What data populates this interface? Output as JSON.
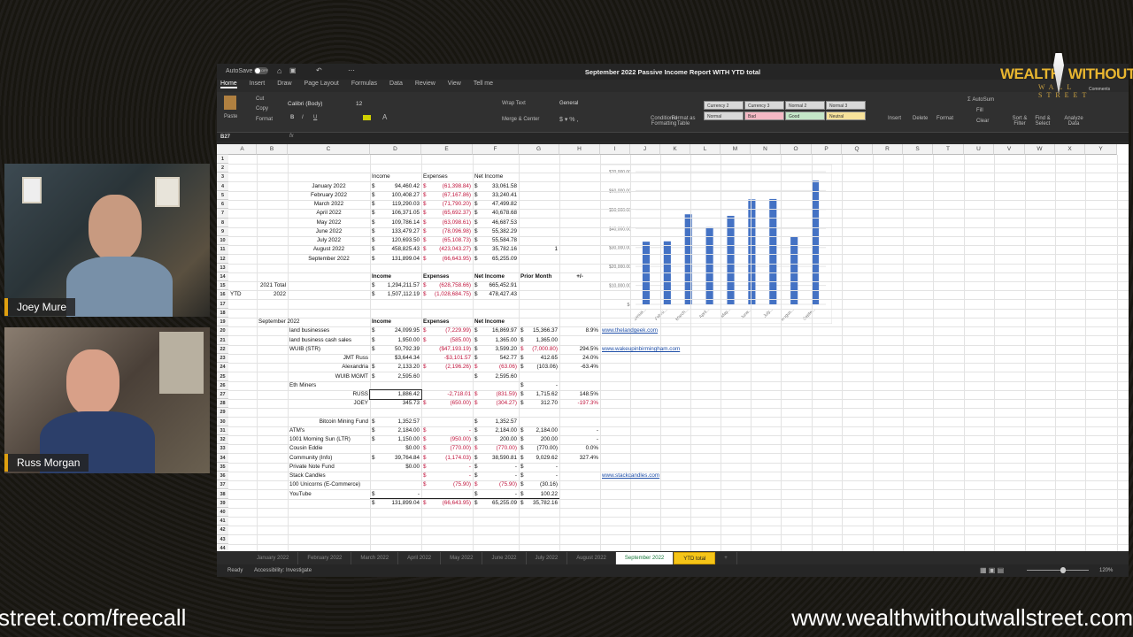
{
  "window": {
    "title": "September 2022 Passive Income Report WITH YTD total",
    "autosave": "AutoSave",
    "autosave_state": "OFF"
  },
  "menu": [
    "Home",
    "Insert",
    "Draw",
    "Page Layout",
    "Formulas",
    "Data",
    "Review",
    "View",
    "Tell me"
  ],
  "ribbon": {
    "paste": "Paste",
    "cut": "Cut",
    "copy": "Copy",
    "format_painter": "Format",
    "font": "Calibri (Body)",
    "font_size": "12",
    "wrap": "Wrap Text",
    "merge": "Merge & Center",
    "number_format": "General",
    "conditional": "Conditional Formatting",
    "format_table": "Format as Table",
    "styles": [
      {
        "label": "Currency 2",
        "color": "#d9d9d9"
      },
      {
        "label": "Currency 3",
        "color": "#d9d9d9"
      },
      {
        "label": "Normal 2",
        "color": "#d9d9d9"
      },
      {
        "label": "Normal 3",
        "color": "#d9d9d9"
      },
      {
        "label": "Normal",
        "color": "#d9d9d9"
      },
      {
        "label": "Bad",
        "color": "#f4b8c4"
      },
      {
        "label": "Good",
        "color": "#c4e6c8"
      },
      {
        "label": "Neutral",
        "color": "#f7e29a"
      }
    ],
    "insert": "Insert",
    "delete": "Delete",
    "format": "Format",
    "autosum": "AutoSum",
    "fill": "Fill",
    "clear": "Clear",
    "sort": "Sort & Filter",
    "find": "Find & Select",
    "analyze": "Analyze Data",
    "comments": "Comments"
  },
  "formula_bar": {
    "cell_ref": "B27",
    "fx": "fx",
    "value": ""
  },
  "columns": [
    "A",
    "B",
    "C",
    "D",
    "E",
    "F",
    "G",
    "H",
    "I",
    "J",
    "K",
    "L",
    "M",
    "N",
    "O",
    "P",
    "Q",
    "R",
    "S",
    "T",
    "U",
    "V",
    "W",
    "X",
    "Y"
  ],
  "rows": [
    {
      "r": 3,
      "cells": [
        [
          "D",
          "Income",
          "l"
        ],
        [
          "E",
          "Expenses",
          "l"
        ],
        [
          "F",
          "Net Income",
          "l"
        ]
      ]
    },
    {
      "r": 4,
      "cells": [
        [
          "C",
          "January 2022",
          "c"
        ],
        [
          "D",
          "$ 94,460.42",
          ""
        ],
        [
          "E",
          "$ (61,398.84)",
          "neg"
        ],
        [
          "F",
          "$ 33,061.58",
          ""
        ]
      ]
    },
    {
      "r": 5,
      "cells": [
        [
          "C",
          "February 2022",
          "c"
        ],
        [
          "D",
          "$ 100,408.27",
          ""
        ],
        [
          "E",
          "$ (67,167.86)",
          "neg"
        ],
        [
          "F",
          "$ 33,240.41",
          ""
        ]
      ]
    },
    {
      "r": 6,
      "cells": [
        [
          "C",
          "March 2022",
          "c"
        ],
        [
          "D",
          "$ 119,290.03",
          ""
        ],
        [
          "E",
          "$ (71,790.20)",
          "neg"
        ],
        [
          "F",
          "$ 47,499.82",
          ""
        ]
      ]
    },
    {
      "r": 7,
      "cells": [
        [
          "C",
          "April 2022",
          "c"
        ],
        [
          "D",
          "$ 106,371.05",
          ""
        ],
        [
          "E",
          "$ (65,692.37)",
          "neg"
        ],
        [
          "F",
          "$ 40,678.68",
          ""
        ]
      ]
    },
    {
      "r": 8,
      "cells": [
        [
          "C",
          "May 2022",
          "c"
        ],
        [
          "D",
          "$ 109,786.14",
          ""
        ],
        [
          "E",
          "$ (63,098.61)",
          "neg"
        ],
        [
          "F",
          "$ 46,687.53",
          ""
        ]
      ]
    },
    {
      "r": 9,
      "cells": [
        [
          "C",
          "June 2022",
          "c"
        ],
        [
          "D",
          "$ 133,479.27",
          ""
        ],
        [
          "E",
          "$ (78,096.98)",
          "neg"
        ],
        [
          "F",
          "$ 55,382.29",
          ""
        ]
      ]
    },
    {
      "r": 10,
      "cells": [
        [
          "C",
          "July 2022",
          "c"
        ],
        [
          "D",
          "$ 120,693.50",
          ""
        ],
        [
          "E",
          "$ (65,108.73)",
          "neg"
        ],
        [
          "F",
          "$ 55,584.78",
          ""
        ]
      ]
    },
    {
      "r": 11,
      "cells": [
        [
          "C",
          "August 2022",
          "c"
        ],
        [
          "D",
          "$ 458,825.43",
          ""
        ],
        [
          "E",
          "$ (423,043.27)",
          "neg"
        ],
        [
          "F",
          "$ 35,782.16",
          ""
        ],
        [
          "G",
          "1",
          ""
        ]
      ]
    },
    {
      "r": 12,
      "cells": [
        [
          "C",
          "September 2022",
          "c"
        ],
        [
          "D",
          "$ 131,899.04",
          ""
        ],
        [
          "E",
          "$ (66,643.95)",
          "neg"
        ],
        [
          "F",
          "$ 65,255.09",
          ""
        ]
      ]
    },
    {
      "r": 14,
      "cells": [
        [
          "D",
          "Income",
          "l b"
        ],
        [
          "E",
          "Expenses",
          "l b"
        ],
        [
          "F",
          "Net Income",
          "l b"
        ],
        [
          "G",
          "Prior Month",
          "l b"
        ],
        [
          "H",
          "+/-",
          "c b"
        ]
      ]
    },
    {
      "r": 15,
      "cells": [
        [
          "B",
          "2021 Total",
          ""
        ],
        [
          "D",
          "$ 1,294,211.57",
          ""
        ],
        [
          "E",
          "$ (628,758.66)",
          "neg"
        ],
        [
          "F",
          "$ 665,452.91",
          ""
        ]
      ]
    },
    {
      "r": 16,
      "cells": [
        [
          "A",
          "YTD",
          "l"
        ],
        [
          "B",
          "2022",
          ""
        ],
        [
          "D",
          "$ 1,507,112.19",
          ""
        ],
        [
          "E",
          "$ (1,028,684.75)",
          "neg"
        ],
        [
          "F",
          "$ 478,427.43",
          ""
        ]
      ]
    },
    {
      "r": 19,
      "cells": [
        [
          "B",
          "September 2022",
          "l"
        ],
        [
          "D",
          "Income",
          "l b"
        ],
        [
          "E",
          "Expenses",
          "l b"
        ],
        [
          "F",
          "Net Income",
          "l b"
        ]
      ]
    },
    {
      "r": 20,
      "cells": [
        [
          "C",
          "land businesses",
          "l"
        ],
        [
          "D",
          "$ 24,099.95",
          ""
        ],
        [
          "E",
          "$ (7,229.99)",
          "neg"
        ],
        [
          "F",
          "$ 16,869.97",
          ""
        ],
        [
          "G",
          "$ 15,366.37",
          ""
        ],
        [
          "H",
          "8.9%",
          ""
        ],
        [
          "I",
          "www.thelandgeek.com",
          "l lnk"
        ]
      ]
    },
    {
      "r": 21,
      "cells": [
        [
          "C",
          "land business cash sales",
          "l"
        ],
        [
          "D",
          "$ 1,950.00",
          ""
        ],
        [
          "E",
          "$ (585.00)",
          "neg"
        ],
        [
          "F",
          "$ 1,365.00",
          ""
        ],
        [
          "G",
          "$ 1,365.00",
          ""
        ]
      ]
    },
    {
      "r": 22,
      "cells": [
        [
          "C",
          "WUIB (STR)",
          "l"
        ],
        [
          "D",
          "$ 50,792.39",
          ""
        ],
        [
          "E",
          "($47,193.19)",
          "neg"
        ],
        [
          "F",
          "$ 3,599.20",
          ""
        ],
        [
          "G",
          "$ (7,000.80)",
          "neg"
        ],
        [
          "H",
          "294.5%",
          ""
        ],
        [
          "I",
          "www.wakeupinbirmingham.com",
          "l lnk"
        ]
      ]
    },
    {
      "r": 23,
      "cells": [
        [
          "C",
          "JMT Russ",
          ""
        ],
        [
          "D",
          "$3,644.34",
          ""
        ],
        [
          "E",
          "-$3,101.57",
          "neg"
        ],
        [
          "F",
          "$ 542.77",
          ""
        ],
        [
          "G",
          "$ 412.65",
          ""
        ],
        [
          "H",
          "24.0%",
          ""
        ]
      ]
    },
    {
      "r": 24,
      "cells": [
        [
          "C",
          "Alexandria",
          ""
        ],
        [
          "D",
          "$ 2,133.20",
          ""
        ],
        [
          "E",
          "$ (2,196.26)",
          "neg"
        ],
        [
          "F",
          "$ (63.06)",
          "neg"
        ],
        [
          "G",
          "$ (103.06)",
          ""
        ],
        [
          "H",
          "-63.4%",
          ""
        ]
      ]
    },
    {
      "r": 25,
      "cells": [
        [
          "C",
          "WUIB MGMT",
          ""
        ],
        [
          "D",
          "$ 2,595.60",
          ""
        ],
        [
          "F",
          "$ 2,595.60",
          ""
        ]
      ]
    },
    {
      "r": 26,
      "cells": [
        [
          "C",
          "Eth Miners",
          "l"
        ],
        [
          "G",
          "$ -",
          ""
        ]
      ]
    },
    {
      "r": 27,
      "cells": [
        [
          "C",
          "RUSS",
          ""
        ],
        [
          "D",
          "1,886.42",
          "box"
        ],
        [
          "E",
          "-2,718.01",
          "neg"
        ],
        [
          "F",
          "$ (831.59)",
          "neg"
        ],
        [
          "G",
          "$ 1,715.62",
          ""
        ],
        [
          "H",
          "148.5%",
          ""
        ]
      ]
    },
    {
      "r": 28,
      "cells": [
        [
          "C",
          "JOEY",
          ""
        ],
        [
          "D",
          "345.73",
          ""
        ],
        [
          "E",
          "$ (650.00)",
          "neg"
        ],
        [
          "F",
          "$ (304.27)",
          "neg"
        ],
        [
          "G",
          "$ 312.70",
          ""
        ],
        [
          "H",
          "-197.3%",
          "neg"
        ]
      ]
    },
    {
      "r": 30,
      "cells": [
        [
          "C",
          "Bitcoin Mining Fund",
          ""
        ],
        [
          "D",
          "$ 1,352.57",
          ""
        ],
        [
          "F",
          "$ 1,352.57",
          ""
        ]
      ]
    },
    {
      "r": 31,
      "cells": [
        [
          "C",
          "ATM's",
          "l"
        ],
        [
          "D",
          "$ 2,184.00",
          ""
        ],
        [
          "E",
          "$ -",
          "neg"
        ],
        [
          "F",
          "$ 2,184.00",
          ""
        ],
        [
          "G",
          "$ 2,184.00",
          ""
        ],
        [
          "H",
          "-",
          ""
        ]
      ]
    },
    {
      "r": 32,
      "cells": [
        [
          "C",
          "1001 Morning Sun (LTR)",
          "l"
        ],
        [
          "D",
          "$ 1,150.00",
          ""
        ],
        [
          "E",
          "$ (950.00)",
          "neg"
        ],
        [
          "F",
          "$ 200.00",
          ""
        ],
        [
          "G",
          "$ 200.00",
          ""
        ],
        [
          "H",
          "-",
          ""
        ]
      ]
    },
    {
      "r": 33,
      "cells": [
        [
          "C",
          "Cousin Eddie",
          "l"
        ],
        [
          "D",
          "$0.00",
          ""
        ],
        [
          "E",
          "$ (770.00)",
          "neg"
        ],
        [
          "F",
          "$ (770.00)",
          "neg"
        ],
        [
          "G",
          "$ (770.00)",
          ""
        ],
        [
          "H",
          "0.0%",
          ""
        ]
      ]
    },
    {
      "r": 34,
      "cells": [
        [
          "C",
          "Community  (Info)",
          "l"
        ],
        [
          "D",
          "$ 39,764.84",
          ""
        ],
        [
          "E",
          "$ (1,174.03)",
          "neg"
        ],
        [
          "F",
          "$ 38,590.81",
          ""
        ],
        [
          "G",
          "$ 9,029.62",
          ""
        ],
        [
          "H",
          "327.4%",
          ""
        ]
      ]
    },
    {
      "r": 35,
      "cells": [
        [
          "C",
          "Private Note Fund",
          "l"
        ],
        [
          "D",
          "$0.00",
          ""
        ],
        [
          "E",
          "$ -",
          "neg"
        ],
        [
          "F",
          "$ -",
          ""
        ],
        [
          "G",
          "$ -",
          ""
        ]
      ]
    },
    {
      "r": 36,
      "cells": [
        [
          "C",
          "Stack Candles",
          "l"
        ],
        [
          "E",
          "$ -",
          "neg"
        ],
        [
          "F",
          "$ -",
          ""
        ],
        [
          "G",
          "$ -",
          ""
        ],
        [
          "I",
          "www.stackcandles.com",
          "l lnk"
        ]
      ]
    },
    {
      "r": 37,
      "cells": [
        [
          "C",
          "100 Unicorns (E-Commerce)",
          "l"
        ],
        [
          "E",
          "$ (75.90)",
          "neg"
        ],
        [
          "F",
          "$ (75.90)",
          "neg"
        ],
        [
          "G",
          "$ (30.16)",
          ""
        ]
      ]
    },
    {
      "r": 38,
      "cells": [
        [
          "C",
          "YouTube",
          "l"
        ],
        [
          "D",
          "$ -",
          ""
        ],
        [
          "F",
          "$ -",
          ""
        ],
        [
          "G",
          "$ 100.22",
          ""
        ]
      ]
    },
    {
      "r": 39,
      "cells": [
        [
          "D",
          "$ 131,899.04",
          ""
        ],
        [
          "E",
          "$ (66,643.95)",
          "neg"
        ],
        [
          "F",
          "$ 65,255.09",
          ""
        ],
        [
          "G",
          "$ 35,782.16",
          ""
        ]
      ]
    }
  ],
  "chart_data": {
    "type": "bar",
    "categories": [
      "Janua...",
      "Febru...",
      "March...",
      "April...",
      "May...",
      "June...",
      "July...",
      "Augus...",
      "Septe..."
    ],
    "values": [
      33061.58,
      33240.41,
      47499.82,
      40678.68,
      46687.53,
      55382.29,
      55584.78,
      35782.16,
      65255.09
    ],
    "ylim": [
      0,
      70000
    ],
    "yticks": [
      "$-",
      "$10,000.00",
      "$20,000.00",
      "$30,000.00",
      "$40,000.00",
      "$50,000.00",
      "$60,000.00",
      "$70,000.00"
    ],
    "color": "#4472c4",
    "grid": true
  },
  "sheet_tabs": [
    "January 2022",
    "February 2022",
    "March 2022",
    "April 2022",
    "May 2022",
    "June 2022",
    "July 2022",
    "August 2022",
    "September 2022",
    "YTD total"
  ],
  "active_tab": "September 2022",
  "status": {
    "ready": "Ready",
    "accessibility": "Accessibility: Investigate",
    "zoom": "120%"
  },
  "participants": [
    {
      "name": "Joey Mure"
    },
    {
      "name": "Russ Morgan"
    }
  ],
  "logo": {
    "line1": "WEALTH WITHOUT",
    "line2": "WALL STREET"
  },
  "banners": {
    "left": "street.com/freecall",
    "right": "www.wealthwithoutwallstreet.com"
  }
}
